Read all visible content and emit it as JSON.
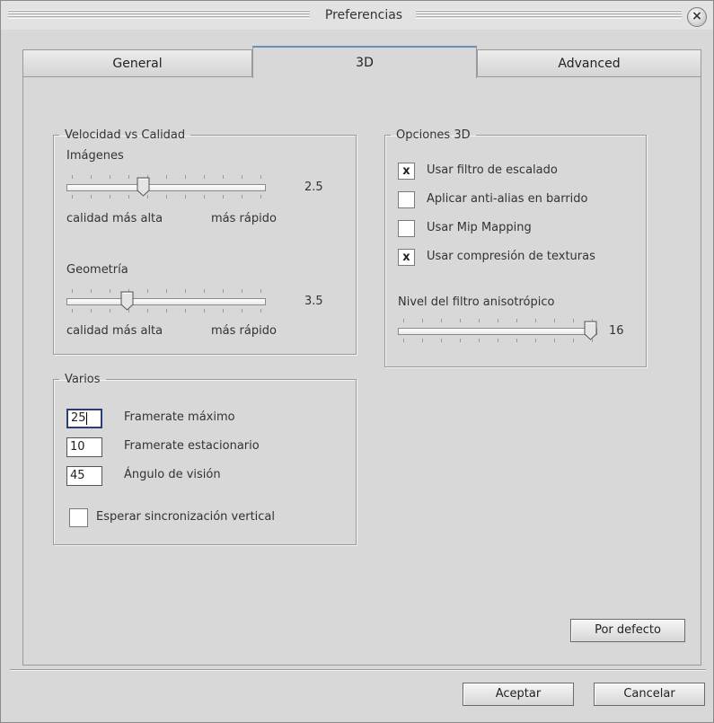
{
  "window": {
    "title": "Preferencias",
    "close_icon": "close-icon"
  },
  "tabs": [
    {
      "label": "General",
      "active": false
    },
    {
      "label": "3D",
      "active": true
    },
    {
      "label": "Advanced",
      "active": false
    }
  ],
  "speed_quality": {
    "legend": "Velocidad vs Calidad",
    "images": {
      "label": "Imágenes",
      "value": "2.5",
      "level": 0.375,
      "min_label": "calidad más alta",
      "max_label": "más rápido"
    },
    "geometry": {
      "label": "Geometría",
      "value": "3.5",
      "level": 0.29,
      "min_label": "calidad más alta",
      "max_label": "más rápido"
    }
  },
  "options_3d": {
    "legend": "Opciones 3D",
    "checkboxes": [
      {
        "label": "Usar filtro de escalado",
        "checked": true,
        "mark": "x"
      },
      {
        "label": "Aplicar anti-alias en barrido",
        "checked": false,
        "mark": ""
      },
      {
        "label": "Usar Mip Mapping",
        "checked": false,
        "mark": ""
      },
      {
        "label": "Usar compresión de texturas",
        "checked": true,
        "mark": "x"
      }
    ],
    "aniso": {
      "label": "Nivel del filtro anisotrópico",
      "value": "16",
      "level": 1.0
    }
  },
  "misc": {
    "legend": "Varios",
    "fields": [
      {
        "value": "25",
        "label": "Framerate máximo",
        "focused": true
      },
      {
        "value": "10",
        "label": "Framerate estacionario",
        "focused": false
      },
      {
        "value": "45",
        "label": "Ángulo de visión",
        "focused": false
      }
    ],
    "vsync": {
      "label": "Esperar sincronización vertical",
      "checked": false
    }
  },
  "buttons": {
    "defaults": "Por defecto",
    "accept": "Aceptar",
    "cancel": "Cancelar"
  }
}
